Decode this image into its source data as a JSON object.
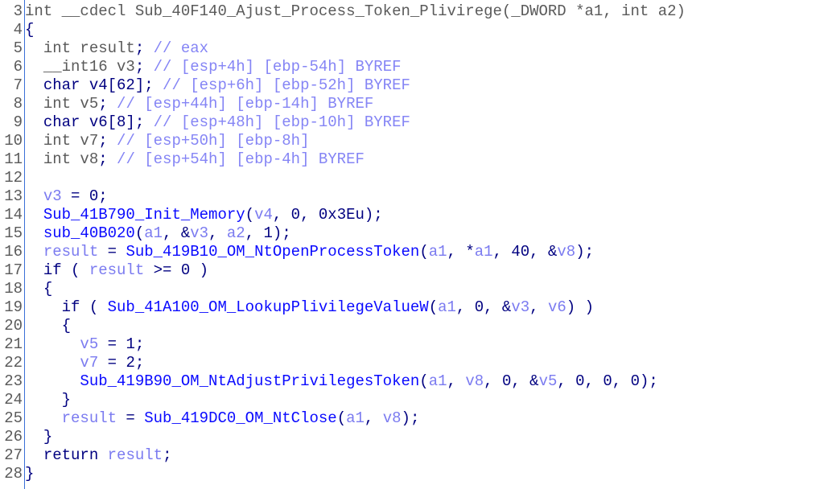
{
  "colors": {
    "gray": "#5a5a5a",
    "navy": "#000080",
    "variable": "#7b7bf0",
    "comment": "#8585f5",
    "function": "#0a0aff",
    "gutter": "#3a6fd8"
  },
  "lines": [
    {
      "num": "3",
      "indent": "",
      "tokens": [
        {
          "t": "g",
          "text": "int __cdecl Sub_40F140_Ajust_Process_Token_Plivirege(_DWORD *a1, int a2)"
        }
      ]
    },
    {
      "num": "4",
      "indent": "",
      "tokens": [
        {
          "t": "n",
          "text": "{"
        }
      ]
    },
    {
      "num": "5",
      "indent": "  ",
      "tokens": [
        {
          "t": "g",
          "text": "int result"
        },
        {
          "t": "n",
          "text": ";"
        },
        {
          "t": "c",
          "text": " // eax"
        }
      ]
    },
    {
      "num": "6",
      "indent": "  ",
      "tokens": [
        {
          "t": "g",
          "text": "__int16 v3"
        },
        {
          "t": "n",
          "text": ";"
        },
        {
          "t": "c",
          "text": " // [esp+4h] [ebp-54h] BYREF"
        }
      ]
    },
    {
      "num": "7",
      "indent": "  ",
      "tokens": [
        {
          "t": "n",
          "text": "char v4[62];"
        },
        {
          "t": "c",
          "text": " // [esp+6h] [ebp-52h] BYREF"
        }
      ]
    },
    {
      "num": "8",
      "indent": "  ",
      "tokens": [
        {
          "t": "g",
          "text": "int v5"
        },
        {
          "t": "n",
          "text": ";"
        },
        {
          "t": "c",
          "text": " // [esp+44h] [ebp-14h] BYREF"
        }
      ]
    },
    {
      "num": "9",
      "indent": "  ",
      "tokens": [
        {
          "t": "n",
          "text": "char v6[8];"
        },
        {
          "t": "c",
          "text": " // [esp+48h] [ebp-10h] BYREF"
        }
      ]
    },
    {
      "num": "10",
      "indent": "  ",
      "tokens": [
        {
          "t": "g",
          "text": "int v7"
        },
        {
          "t": "n",
          "text": ";"
        },
        {
          "t": "c",
          "text": " // [esp+50h] [ebp-8h]"
        }
      ]
    },
    {
      "num": "11",
      "indent": "  ",
      "tokens": [
        {
          "t": "g",
          "text": "int v8"
        },
        {
          "t": "n",
          "text": ";"
        },
        {
          "t": "c",
          "text": " // [esp+54h] [ebp-4h] BYREF"
        }
      ]
    },
    {
      "num": "12",
      "indent": "",
      "tokens": []
    },
    {
      "num": "13",
      "indent": "  ",
      "tokens": [
        {
          "t": "v",
          "text": "v3"
        },
        {
          "t": "n",
          "text": " = 0;"
        }
      ]
    },
    {
      "num": "14",
      "indent": "  ",
      "tokens": [
        {
          "t": "f",
          "text": "Sub_41B790_Init_Memory"
        },
        {
          "t": "n",
          "text": "("
        },
        {
          "t": "v",
          "text": "v4"
        },
        {
          "t": "n",
          "text": ", 0, 0x3Eu);"
        }
      ]
    },
    {
      "num": "15",
      "indent": "  ",
      "tokens": [
        {
          "t": "f",
          "text": "sub_40B020"
        },
        {
          "t": "n",
          "text": "("
        },
        {
          "t": "v",
          "text": "a1"
        },
        {
          "t": "n",
          "text": ", &"
        },
        {
          "t": "v",
          "text": "v3"
        },
        {
          "t": "n",
          "text": ", "
        },
        {
          "t": "v",
          "text": "a2"
        },
        {
          "t": "n",
          "text": ", 1);"
        }
      ]
    },
    {
      "num": "16",
      "indent": "  ",
      "tokens": [
        {
          "t": "v",
          "text": "result"
        },
        {
          "t": "n",
          "text": " = "
        },
        {
          "t": "f",
          "text": "Sub_419B10_OM_NtOpenProcessToken"
        },
        {
          "t": "n",
          "text": "("
        },
        {
          "t": "v",
          "text": "a1"
        },
        {
          "t": "n",
          "text": ", *"
        },
        {
          "t": "v",
          "text": "a1"
        },
        {
          "t": "n",
          "text": ", 40, &"
        },
        {
          "t": "v",
          "text": "v8"
        },
        {
          "t": "n",
          "text": ");"
        }
      ]
    },
    {
      "num": "17",
      "indent": "  ",
      "tokens": [
        {
          "t": "n",
          "text": "if ( "
        },
        {
          "t": "v",
          "text": "result"
        },
        {
          "t": "n",
          "text": " >= 0 )"
        }
      ]
    },
    {
      "num": "18",
      "indent": "  ",
      "tokens": [
        {
          "t": "n",
          "text": "{"
        }
      ]
    },
    {
      "num": "19",
      "indent": "    ",
      "tokens": [
        {
          "t": "n",
          "text": "if ( "
        },
        {
          "t": "f",
          "text": "Sub_41A100_OM_LookupPlivilegeValueW"
        },
        {
          "t": "n",
          "text": "("
        },
        {
          "t": "v",
          "text": "a1"
        },
        {
          "t": "n",
          "text": ", 0, &"
        },
        {
          "t": "v",
          "text": "v3"
        },
        {
          "t": "n",
          "text": ", "
        },
        {
          "t": "v",
          "text": "v6"
        },
        {
          "t": "n",
          "text": ") )"
        }
      ]
    },
    {
      "num": "20",
      "indent": "    ",
      "tokens": [
        {
          "t": "n",
          "text": "{"
        }
      ]
    },
    {
      "num": "21",
      "indent": "      ",
      "tokens": [
        {
          "t": "v",
          "text": "v5"
        },
        {
          "t": "n",
          "text": " = 1;"
        }
      ]
    },
    {
      "num": "22",
      "indent": "      ",
      "tokens": [
        {
          "t": "v",
          "text": "v7"
        },
        {
          "t": "n",
          "text": " = 2;"
        }
      ]
    },
    {
      "num": "23",
      "indent": "      ",
      "tokens": [
        {
          "t": "f",
          "text": "Sub_419B90_OM_NtAdjustPrivilegesToken"
        },
        {
          "t": "n",
          "text": "("
        },
        {
          "t": "v",
          "text": "a1"
        },
        {
          "t": "n",
          "text": ", "
        },
        {
          "t": "v",
          "text": "v8"
        },
        {
          "t": "n",
          "text": ", 0, &"
        },
        {
          "t": "v",
          "text": "v5"
        },
        {
          "t": "n",
          "text": ", 0, 0, 0);"
        }
      ]
    },
    {
      "num": "24",
      "indent": "    ",
      "tokens": [
        {
          "t": "n",
          "text": "}"
        }
      ]
    },
    {
      "num": "25",
      "indent": "    ",
      "tokens": [
        {
          "t": "v",
          "text": "result"
        },
        {
          "t": "n",
          "text": " = "
        },
        {
          "t": "f",
          "text": "Sub_419DC0_OM_NtClose"
        },
        {
          "t": "n",
          "text": "("
        },
        {
          "t": "v",
          "text": "a1"
        },
        {
          "t": "n",
          "text": ", "
        },
        {
          "t": "v",
          "text": "v8"
        },
        {
          "t": "n",
          "text": ");"
        }
      ]
    },
    {
      "num": "26",
      "indent": "  ",
      "tokens": [
        {
          "t": "n",
          "text": "}"
        }
      ]
    },
    {
      "num": "27",
      "indent": "  ",
      "tokens": [
        {
          "t": "n",
          "text": "return "
        },
        {
          "t": "v",
          "text": "result"
        },
        {
          "t": "n",
          "text": ";"
        }
      ]
    },
    {
      "num": "28",
      "indent": "",
      "tokens": [
        {
          "t": "n",
          "text": "}"
        }
      ]
    }
  ]
}
